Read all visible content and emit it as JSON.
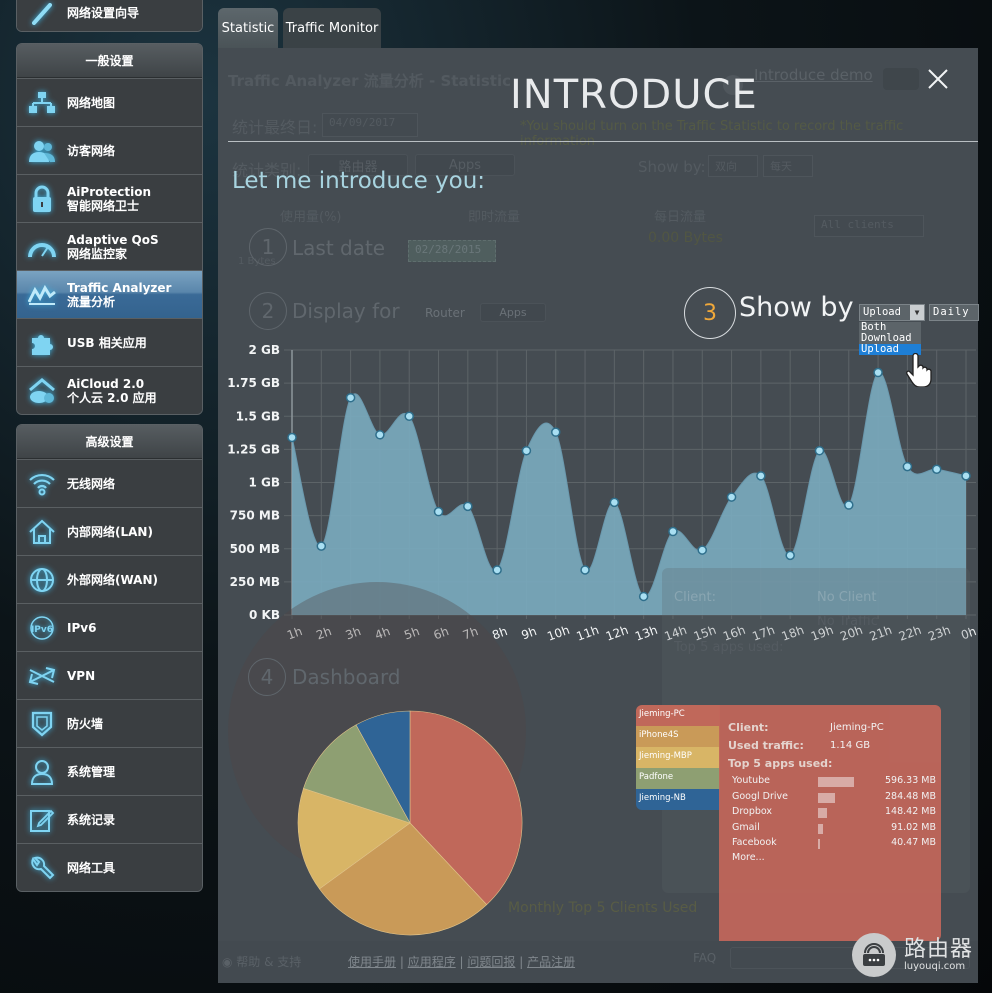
{
  "sidebar": {
    "top_item_partial": "网络设置向导",
    "general": {
      "header": "一般设置",
      "items": [
        {
          "icon": "network-map-icon",
          "line1": "网络地图",
          "line2": ""
        },
        {
          "icon": "guest-network-icon",
          "line1": "访客网络",
          "line2": ""
        },
        {
          "icon": "lock-icon",
          "line1": "AiProtection",
          "line2": "智能网络卫士"
        },
        {
          "icon": "speedometer-icon",
          "line1": "Adaptive QoS",
          "line2": "网络监控家"
        },
        {
          "icon": "traffic-analyzer-icon",
          "line1": "Traffic Analyzer",
          "line2": "流量分析",
          "active": true
        },
        {
          "icon": "puzzle-icon",
          "line1": "USB 相关应用",
          "line2": ""
        },
        {
          "icon": "cloud-home-icon",
          "line1": "AiCloud 2.0",
          "line2": "个人云 2.0 应用"
        }
      ]
    },
    "advanced": {
      "header": "高级设置",
      "items": [
        {
          "icon": "wifi-icon",
          "label": "无线网络"
        },
        {
          "icon": "home-icon",
          "label": "内部网络(LAN)"
        },
        {
          "icon": "globe-icon",
          "label": "外部网络(WAN)"
        },
        {
          "icon": "ipv6-icon",
          "label": "IPv6"
        },
        {
          "icon": "vpn-icon",
          "label": "VPN"
        },
        {
          "icon": "shield-icon",
          "label": "防火墙"
        },
        {
          "icon": "user-admin-icon",
          "label": "系统管理"
        },
        {
          "icon": "edit-log-icon",
          "label": "系统记录"
        },
        {
          "icon": "wrench-icon",
          "label": "网络工具"
        }
      ]
    }
  },
  "tabs": [
    {
      "label": "Statistic",
      "active": true
    },
    {
      "label": "Traffic Monitor",
      "active": false
    }
  ],
  "background_page": {
    "title": "Traffic Analyzer 流量分析 - Statistic",
    "demo_link": "Introduce demo",
    "last_date_label": "统计最终日:",
    "last_date_value": "04/09/2017",
    "note": "*You should turn on the Traffic Statistic to record the traffic information",
    "category_label": "统计类别:",
    "category_router": "路由器",
    "category_apps": "Apps",
    "show_by_label": "Show by:",
    "show_by_dir": "双向",
    "show_by_period": "每天",
    "col_usage": "使用量(%)",
    "col_realtime": "即时流量",
    "col_daily": "每日流量",
    "daily_value": "0.00 Bytes",
    "clients_select": "All clients",
    "one_bytes": "1 Bytes",
    "client_label": "Client:",
    "no_client": "No Client",
    "no_traffic": "No Traffic",
    "top5_ghost": "Top 5 apps used:",
    "monthly_caption": "Monthly Top 5 Clients Used"
  },
  "intro": {
    "title": "INTRODUCE",
    "subtitle": "Let me introduce you:",
    "steps": [
      {
        "num": "1",
        "label": "Last date",
        "value": "02/28/2015"
      },
      {
        "num": "2",
        "label": "Display for",
        "option_router": "Router",
        "option_apps": "Apps"
      },
      {
        "num": "3",
        "label": "Show by"
      },
      {
        "num": "4",
        "label": "Dashboard"
      }
    ],
    "show_by_dropdown": {
      "selected": "Upload",
      "options": [
        "Both",
        "Download",
        "Upload"
      ],
      "highlighted": "Upload",
      "period": "Daily"
    }
  },
  "chart_data": [
    {
      "type": "area",
      "title": "",
      "xlabel": "",
      "ylabel": "",
      "x": [
        "1h",
        "2h",
        "3h",
        "4h",
        "5h",
        "6h",
        "7h",
        "8h",
        "9h",
        "10h",
        "11h",
        "12h",
        "13h",
        "14h",
        "15h",
        "16h",
        "17h",
        "18h",
        "19h",
        "20h",
        "21h",
        "22h",
        "23h",
        "0h"
      ],
      "series": [
        {
          "name": "Upload",
          "unit": "GB",
          "values": [
            1.34,
            0.52,
            1.64,
            1.36,
            1.5,
            0.78,
            0.82,
            0.34,
            1.24,
            1.38,
            0.34,
            0.85,
            0.14,
            0.63,
            0.49,
            0.89,
            1.05,
            0.45,
            1.24,
            0.83,
            1.83,
            1.12,
            1.1,
            1.05
          ]
        }
      ],
      "yticks": [
        "0 KB",
        "250 MB",
        "500 MB",
        "750 MB",
        "1 GB",
        "1.25 GB",
        "1.5 GB",
        "1.75 GB",
        "2 GB"
      ],
      "ylim": [
        0,
        2
      ],
      "grid": true,
      "color": "#7aa9bd"
    },
    {
      "type": "pie",
      "title": "Monthly Top 5 Clients Used",
      "slices": [
        {
          "name": "Jieming-PC",
          "value": 38,
          "color": "#c0685a"
        },
        {
          "name": "iPhone4S",
          "value": 27,
          "color": "#c99a58"
        },
        {
          "name": "Jieming-MBP",
          "value": 15,
          "color": "#d8b566"
        },
        {
          "name": "Padfone",
          "value": 12,
          "color": "#8e9f72"
        },
        {
          "name": "Jieming-NB",
          "value": 8,
          "color": "#2f6496"
        }
      ]
    }
  ],
  "client_details": {
    "client_label": "Client:",
    "client_value": "Jieming-PC",
    "traffic_label": "Used traffic:",
    "traffic_value": "1.14 GB",
    "top5_label": "Top 5 apps used:",
    "apps": [
      {
        "name": "Youtube",
        "value": "596.33 MB",
        "mb": 596.33
      },
      {
        "name": "Googl Drive",
        "value": "284.48 MB",
        "mb": 284.48
      },
      {
        "name": "Dropbox",
        "value": "148.42 MB",
        "mb": 148.42
      },
      {
        "name": "Gmail",
        "value": "91.02 MB",
        "mb": 91.02
      },
      {
        "name": "Facebook",
        "value": "40.47 MB",
        "mb": 40.47
      }
    ],
    "more": "More..."
  },
  "footer": {
    "help": "帮助 & 支持",
    "links": [
      "使用手册",
      "应用程序",
      "问题回报",
      "产品注册"
    ],
    "faq": "FAQ"
  },
  "watermark": {
    "cn": "路由器",
    "en": "luyouqi.com"
  }
}
